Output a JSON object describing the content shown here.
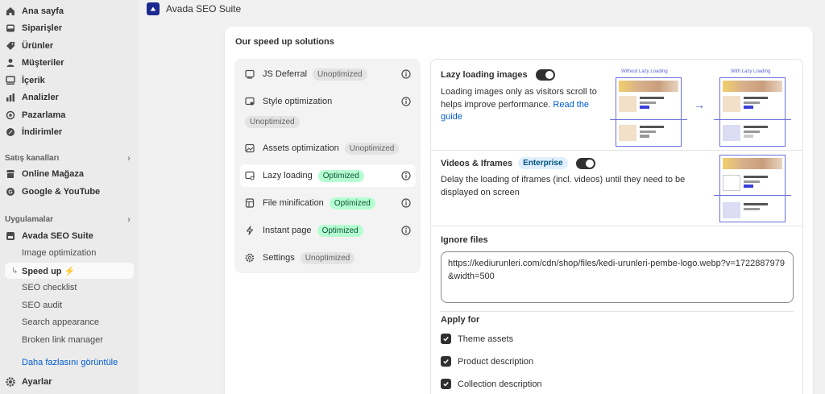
{
  "sidebar": {
    "nav": [
      {
        "label": "Ana sayfa",
        "icon": "home-icon"
      },
      {
        "label": "Siparişler",
        "icon": "inbox-icon"
      },
      {
        "label": "Ürünler",
        "icon": "tag-icon"
      },
      {
        "label": "Müşteriler",
        "icon": "person-icon"
      },
      {
        "label": "İçerik",
        "icon": "content-icon"
      },
      {
        "label": "Analizler",
        "icon": "bar-chart-icon"
      },
      {
        "label": "Pazarlama",
        "icon": "target-icon"
      },
      {
        "label": "İndirimler",
        "icon": "discount-icon"
      }
    ],
    "sales_channels_label": "Satış kanalları",
    "channels": [
      {
        "label": "Online Mağaza",
        "icon": "store-icon"
      },
      {
        "label": "Google & YouTube",
        "icon": "google-icon"
      }
    ],
    "apps_label": "Uygulamalar",
    "app": {
      "label": "Avada SEO Suite",
      "icon": "app-icon"
    },
    "sub_items": [
      {
        "label": "Image optimization"
      },
      {
        "label": "Speed up ⚡",
        "active": true
      },
      {
        "label": "SEO checklist"
      },
      {
        "label": "SEO audit"
      },
      {
        "label": "Search appearance"
      },
      {
        "label": "Broken link manager"
      }
    ],
    "more_link": "Daha fazlasını görüntüle",
    "settings": {
      "label": "Ayarlar",
      "icon": "gear-icon"
    }
  },
  "header": {
    "title": "Avada SEO Suite"
  },
  "main": {
    "title": "Our speed up solutions",
    "solutions": [
      {
        "label": "JS Deferral",
        "status": "Unoptimized",
        "icon": "js-icon"
      },
      {
        "label": "Style optimization",
        "status": "Unoptimized",
        "icon": "style-icon"
      },
      {
        "label": "Assets optimization",
        "status": "Unoptimized",
        "icon": "assets-icon"
      },
      {
        "label": "Lazy loading",
        "status": "Optimized",
        "icon": "lazy-icon",
        "selected": true
      },
      {
        "label": "File minification",
        "status": "Optimized",
        "icon": "file-icon"
      },
      {
        "label": "Instant page",
        "status": "Optimized",
        "icon": "lightning-icon"
      },
      {
        "label": "Settings",
        "status": "Unoptimized",
        "icon": "gear-icon"
      }
    ],
    "lazy_images": {
      "title": "Lazy loading images",
      "enabled": true,
      "desc": "Loading images only as visitors scroll to helps improve performance.",
      "link": "Read the guide",
      "without_label": "Without Lazy Loading",
      "with_label": "With Lazy Loading"
    },
    "videos": {
      "title": "Videos & Iframes",
      "badge": "Enterprise",
      "enabled": true,
      "desc": "Delay the loading of iframes (incl. videos) until they need to be displayed on screen"
    },
    "ignore_files": {
      "label": "Ignore files",
      "value": "https://kediurunleri.com/cdn/shop/files/kedi-urunleri-pembe-logo.webp?v=1722887979&width=500"
    },
    "apply_for": {
      "label": "Apply for",
      "options": [
        {
          "label": "Theme assets",
          "checked": true
        },
        {
          "label": "Product description",
          "checked": true
        },
        {
          "label": "Collection description",
          "checked": true
        }
      ]
    }
  }
}
